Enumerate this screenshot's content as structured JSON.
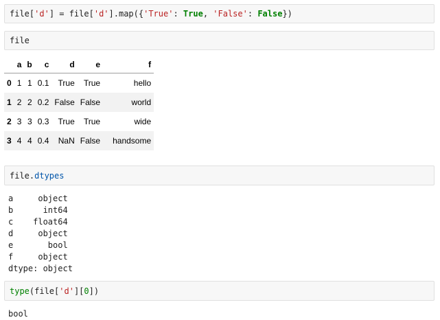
{
  "cells": [
    {
      "code_parts": [
        {
          "text": "file[",
          "cls": ""
        },
        {
          "text": "'d'",
          "cls": "str"
        },
        {
          "text": "] = file[",
          "cls": ""
        },
        {
          "text": "'d'",
          "cls": "str"
        },
        {
          "text": "].map({",
          "cls": ""
        },
        {
          "text": "'True'",
          "cls": "str"
        },
        {
          "text": ": ",
          "cls": ""
        },
        {
          "text": "True",
          "cls": "kw"
        },
        {
          "text": ", ",
          "cls": ""
        },
        {
          "text": "'False'",
          "cls": "str"
        },
        {
          "text": ": ",
          "cls": ""
        },
        {
          "text": "False",
          "cls": "kw"
        },
        {
          "text": "})",
          "cls": ""
        }
      ]
    },
    {
      "code_parts": [
        {
          "text": "file",
          "cls": ""
        }
      ]
    },
    {
      "code_parts": [
        {
          "text": "file.",
          "cls": ""
        },
        {
          "text": "dtypes",
          "cls": "attr"
        }
      ]
    },
    {
      "code_parts": [
        {
          "text": "type",
          "cls": "fn"
        },
        {
          "text": "(file[",
          "cls": ""
        },
        {
          "text": "'d'",
          "cls": "str"
        },
        {
          "text": "][",
          "cls": ""
        },
        {
          "text": "0",
          "cls": "fn"
        },
        {
          "text": "])",
          "cls": ""
        }
      ]
    }
  ],
  "dataframe": {
    "columns": [
      "",
      "a",
      "b",
      "c",
      "d",
      "e",
      "f"
    ],
    "rows": [
      [
        "0",
        "1",
        "1",
        "0.1",
        "True",
        "True",
        "hello"
      ],
      [
        "1",
        "2",
        "2",
        "0.2",
        "False",
        "False",
        "world"
      ],
      [
        "2",
        "3",
        "3",
        "0.3",
        "True",
        "True",
        "wide"
      ],
      [
        "3",
        "4",
        "4",
        "0.4",
        "NaN",
        "False",
        "handsome"
      ]
    ]
  },
  "dtypes_output": [
    "a     object",
    "b      int64",
    "c    float64",
    "d     object",
    "e       bool",
    "f     object",
    "dtype: object"
  ],
  "type_output": "bool"
}
